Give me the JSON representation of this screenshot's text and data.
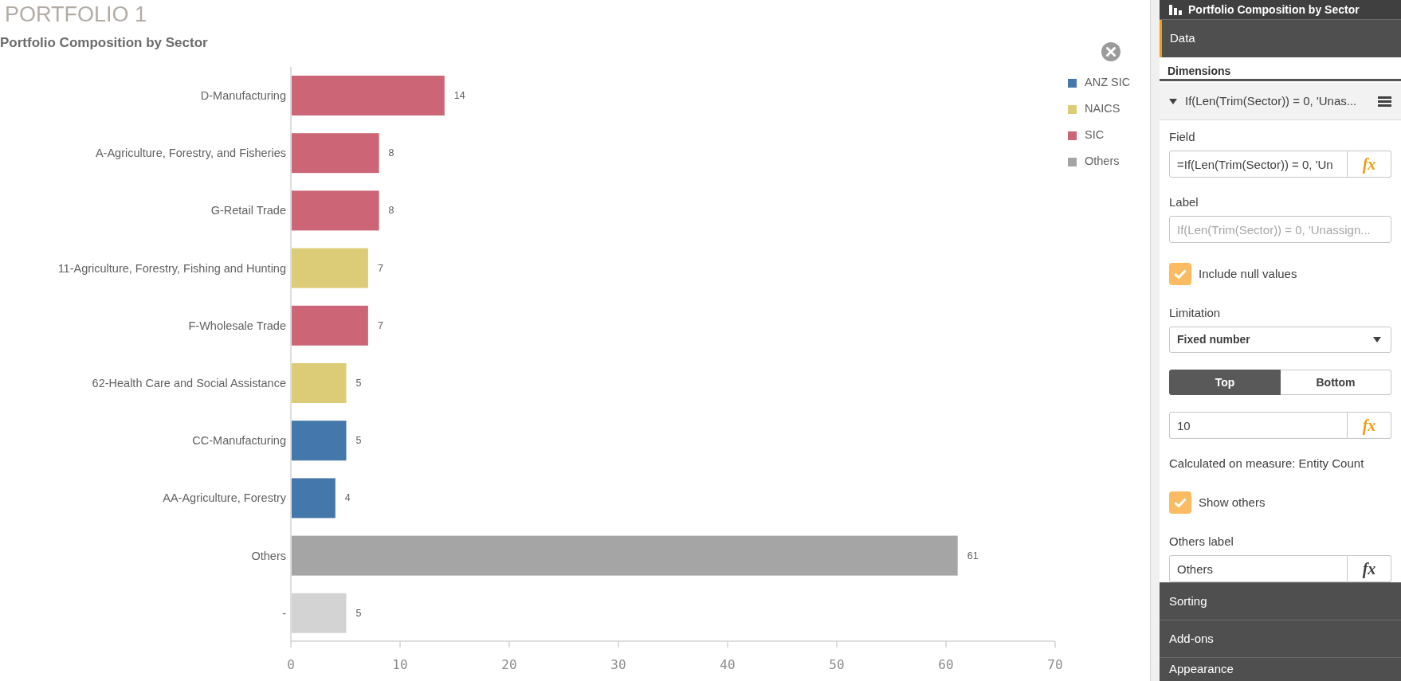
{
  "sheet_title": "PORTFOLIO 1",
  "chart": {
    "chart_data": {
      "type": "bar",
      "title": "Portfolio Composition by Sector",
      "orientation": "horizontal",
      "categories": [
        "D-Manufacturing",
        "A-Agriculture, Forestry, and Fisheries",
        "G-Retail Trade",
        "11-Agriculture, Forestry, Fishing and Hunting",
        "F-Wholesale Trade",
        "62-Health Care and Social Assistance",
        "CC-Manufacturing",
        "AA-Agriculture, Forestry",
        "Others",
        "-"
      ],
      "series": [
        {
          "name": "ANZ SIC",
          "color": "#4477aa",
          "values": [
            null,
            null,
            null,
            null,
            null,
            null,
            5,
            4,
            null,
            null
          ]
        },
        {
          "name": "NAICS",
          "color": "#ddcc77",
          "values": [
            null,
            null,
            null,
            7,
            null,
            5,
            null,
            null,
            null,
            null
          ]
        },
        {
          "name": "SIC",
          "color": "#cc6677",
          "values": [
            14,
            8,
            8,
            null,
            7,
            null,
            null,
            null,
            null,
            null
          ]
        },
        {
          "name": "Others",
          "color": "#a5a5a5",
          "values": [
            null,
            null,
            null,
            null,
            null,
            null,
            null,
            null,
            61,
            null
          ]
        },
        {
          "color": "#d3d3d3",
          "values": [
            null,
            null,
            null,
            null,
            null,
            null,
            null,
            null,
            null,
            5
          ]
        }
      ],
      "xlim": [
        0,
        70
      ],
      "xticks": [
        0,
        10,
        20,
        30,
        40,
        50,
        60,
        70
      ],
      "value_labels": [
        "14",
        "8",
        "8",
        "7",
        "7",
        "5",
        "5",
        "4",
        "61",
        "5"
      ]
    }
  },
  "properties_panel": {
    "title": "Portfolio Composition by Sector",
    "sections": [
      {
        "label": "Data",
        "expanded": true
      },
      {
        "label": "Sorting",
        "expanded": false
      },
      {
        "label": "Add-ons",
        "expanded": false
      },
      {
        "label": "Appearance",
        "expanded": false
      }
    ],
    "dimensions": {
      "heading": "Dimensions",
      "items": [
        {
          "label": "If(Len(Trim(Sector)) = 0, 'Unas...",
          "expanded": true,
          "controls": [
            {
              "kind": "input",
              "label": "Field",
              "value": "=If(Len(Trim(Sector)) = 0, 'Un",
              "formula": "fx",
              "expression": true
            },
            {
              "kind": "input",
              "label": "Label",
              "placeholder": "If(Len(Trim(Sector)) = 0, 'Unassign..."
            },
            {
              "kind": "checkbox",
              "label": "Include null values",
              "checked": true
            },
            {
              "kind": "select",
              "label": "Limitation",
              "value": "Fixed number"
            },
            {
              "kind": "toggle",
              "options": [
                {
                  "label": "Top",
                  "selected": true
                },
                {
                  "label": "Bottom",
                  "selected": false
                }
              ]
            },
            {
              "kind": "input",
              "value": "10",
              "formula": "fx",
              "expression": true
            },
            {
              "kind": "note",
              "text": "Calculated on measure: Entity Count"
            },
            {
              "kind": "checkbox",
              "label": "Show others",
              "checked": true
            },
            {
              "kind": "input",
              "label": "Others label",
              "value": "Others",
              "formula": "fx",
              "expression": false
            }
          ]
        }
      ]
    }
  }
}
